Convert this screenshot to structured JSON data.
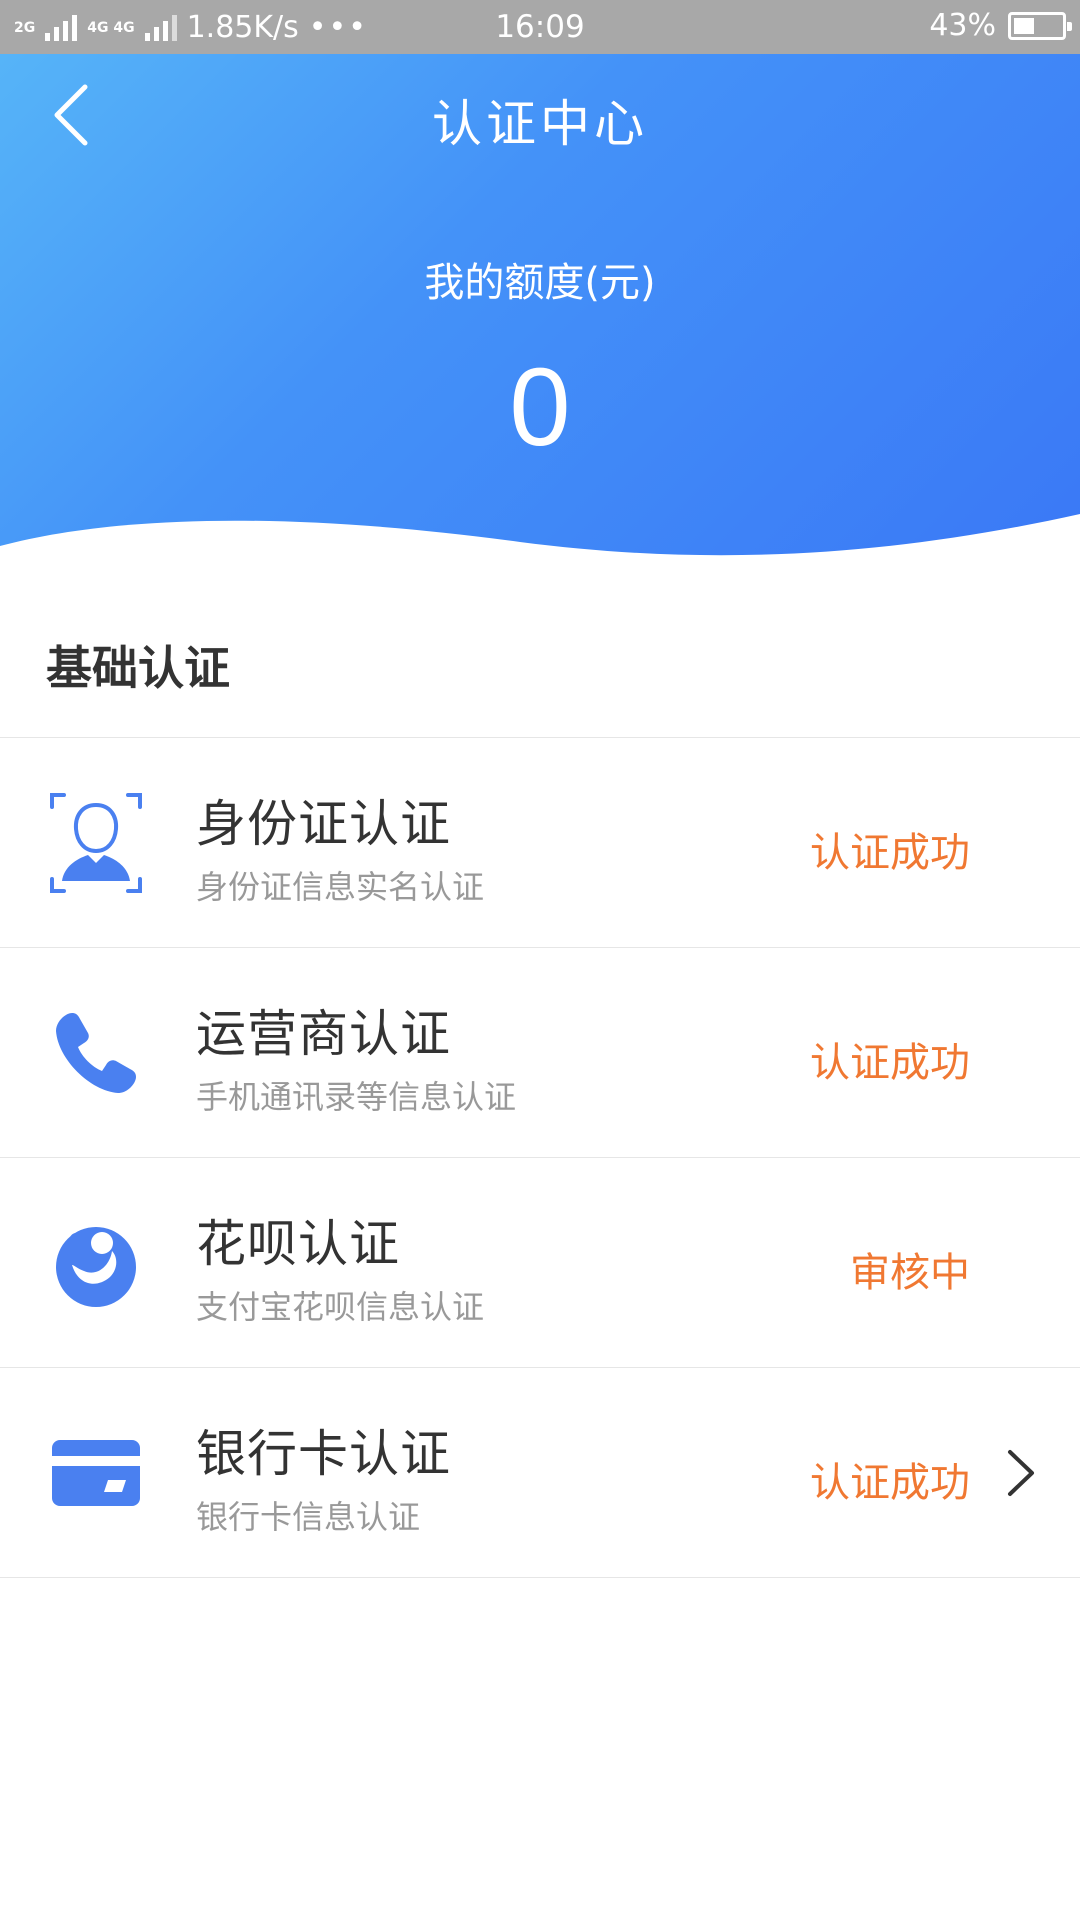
{
  "status_bar": {
    "net1": "2G",
    "net2": "4G 4G",
    "speed": "1.85K/s",
    "dots": "•••",
    "time": "16:09",
    "battery_text": "43%",
    "battery_level": 0.43
  },
  "header": {
    "title": "认证中心",
    "quota_label": "我的额度(元)",
    "quota_value": "0"
  },
  "section": {
    "title": "基础认证"
  },
  "items": [
    {
      "icon": "id-face-icon",
      "title": "身份证认证",
      "subtitle": "身份证信息实名认证",
      "status": "认证成功"
    },
    {
      "icon": "phone-icon",
      "title": "运营商认证",
      "subtitle": "手机通讯录等信息认证",
      "status": "认证成功"
    },
    {
      "icon": "huabei-icon",
      "title": "花呗认证",
      "subtitle": "支付宝花呗信息认证",
      "status": "审核中"
    },
    {
      "icon": "bank-card-icon",
      "title": "银行卡认证",
      "subtitle": "银行卡信息认证",
      "status": "认证成功"
    }
  ],
  "colors": {
    "accent_blue": "#3a78f6",
    "status_orange": "#f07832"
  }
}
